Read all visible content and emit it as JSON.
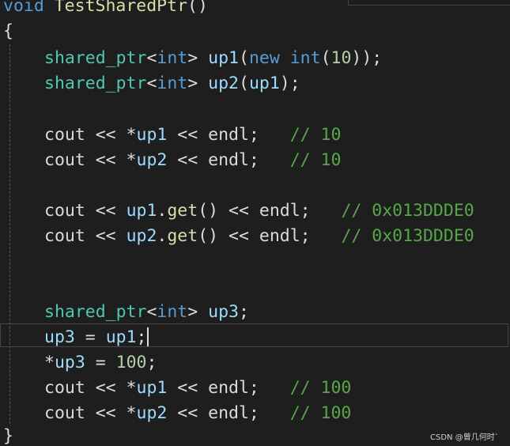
{
  "watermark": "CSDN @曾几何时`",
  "nav": {
    "dropdown_arrow": "▾"
  },
  "lines": [
    {
      "id": "l0",
      "tokens": [
        {
          "t": "void",
          "c": "kw"
        },
        {
          "t": " ",
          "c": "pln"
        },
        {
          "t": "TestSharedPtr",
          "c": "fn"
        },
        {
          "t": "()",
          "c": "pln"
        }
      ]
    },
    {
      "id": "l1",
      "tokens": [
        {
          "t": "{",
          "c": "pln"
        }
      ]
    },
    {
      "id": "l2",
      "tokens": [
        {
          "t": "shared_ptr",
          "c": "type"
        },
        {
          "t": "<",
          "c": "pln"
        },
        {
          "t": "int",
          "c": "kw"
        },
        {
          "t": "> ",
          "c": "pln"
        },
        {
          "t": "up1",
          "c": "var"
        },
        {
          "t": "(",
          "c": "pln"
        },
        {
          "t": "new",
          "c": "kw"
        },
        {
          "t": " ",
          "c": "pln"
        },
        {
          "t": "int",
          "c": "kw"
        },
        {
          "t": "(",
          "c": "pln"
        },
        {
          "t": "10",
          "c": "num"
        },
        {
          "t": "));",
          "c": "pln"
        }
      ]
    },
    {
      "id": "l3",
      "tokens": [
        {
          "t": "shared_ptr",
          "c": "type"
        },
        {
          "t": "<",
          "c": "pln"
        },
        {
          "t": "int",
          "c": "kw"
        },
        {
          "t": "> ",
          "c": "pln"
        },
        {
          "t": "up2",
          "c": "var"
        },
        {
          "t": "(",
          "c": "pln"
        },
        {
          "t": "up1",
          "c": "var"
        },
        {
          "t": ");",
          "c": "pln"
        }
      ]
    },
    {
      "id": "l5",
      "tokens": [
        {
          "t": "cout",
          "c": "pln"
        },
        {
          "t": " << *",
          "c": "pln"
        },
        {
          "t": "up1",
          "c": "var"
        },
        {
          "t": " << ",
          "c": "pln"
        },
        {
          "t": "endl",
          "c": "pln"
        },
        {
          "t": ";   ",
          "c": "pln"
        },
        {
          "t": "// 10",
          "c": "cmt"
        }
      ]
    },
    {
      "id": "l6",
      "tokens": [
        {
          "t": "cout",
          "c": "pln"
        },
        {
          "t": " << *",
          "c": "pln"
        },
        {
          "t": "up2",
          "c": "var"
        },
        {
          "t": " << ",
          "c": "pln"
        },
        {
          "t": "endl",
          "c": "pln"
        },
        {
          "t": ";   ",
          "c": "pln"
        },
        {
          "t": "// 10",
          "c": "cmt"
        }
      ]
    },
    {
      "id": "l8",
      "tokens": [
        {
          "t": "cout",
          "c": "pln"
        },
        {
          "t": " << ",
          "c": "pln"
        },
        {
          "t": "up1",
          "c": "var"
        },
        {
          "t": ".",
          "c": "pln"
        },
        {
          "t": "get",
          "c": "fn"
        },
        {
          "t": "() << ",
          "c": "pln"
        },
        {
          "t": "endl",
          "c": "pln"
        },
        {
          "t": ";   ",
          "c": "pln"
        },
        {
          "t": "// 0x013DDDE0",
          "c": "cmt"
        }
      ]
    },
    {
      "id": "l9",
      "tokens": [
        {
          "t": "cout",
          "c": "pln"
        },
        {
          "t": " << ",
          "c": "pln"
        },
        {
          "t": "up2",
          "c": "var"
        },
        {
          "t": ".",
          "c": "pln"
        },
        {
          "t": "get",
          "c": "fn"
        },
        {
          "t": "() << ",
          "c": "pln"
        },
        {
          "t": "endl",
          "c": "pln"
        },
        {
          "t": ";   ",
          "c": "pln"
        },
        {
          "t": "// 0x013DDDE0",
          "c": "cmt"
        }
      ]
    },
    {
      "id": "l12",
      "tokens": [
        {
          "t": "shared_ptr",
          "c": "type"
        },
        {
          "t": "<",
          "c": "pln"
        },
        {
          "t": "int",
          "c": "kw"
        },
        {
          "t": "> ",
          "c": "pln"
        },
        {
          "t": "up3",
          "c": "var"
        },
        {
          "t": ";",
          "c": "pln"
        }
      ]
    },
    {
      "id": "l13",
      "tokens": [
        {
          "t": "up3",
          "c": "var"
        },
        {
          "t": " = ",
          "c": "pln"
        },
        {
          "t": "up1",
          "c": "var"
        },
        {
          "t": ";",
          "c": "pln"
        }
      ]
    },
    {
      "id": "l14",
      "tokens": [
        {
          "t": "*",
          "c": "pln"
        },
        {
          "t": "up3",
          "c": "var"
        },
        {
          "t": " = ",
          "c": "pln"
        },
        {
          "t": "100",
          "c": "num"
        },
        {
          "t": ";",
          "c": "pln"
        }
      ]
    },
    {
      "id": "l15",
      "tokens": [
        {
          "t": "cout",
          "c": "pln"
        },
        {
          "t": " << *",
          "c": "pln"
        },
        {
          "t": "up1",
          "c": "var"
        },
        {
          "t": " << ",
          "c": "pln"
        },
        {
          "t": "endl",
          "c": "pln"
        },
        {
          "t": ";   ",
          "c": "pln"
        },
        {
          "t": "// 100",
          "c": "cmt"
        }
      ]
    },
    {
      "id": "l16",
      "tokens": [
        {
          "t": "cout",
          "c": "pln"
        },
        {
          "t": " << *",
          "c": "pln"
        },
        {
          "t": "up2",
          "c": "var"
        },
        {
          "t": " << ",
          "c": "pln"
        },
        {
          "t": "endl",
          "c": "pln"
        },
        {
          "t": ";   ",
          "c": "pln"
        },
        {
          "t": "// 100",
          "c": "cmt"
        }
      ]
    },
    {
      "id": "l17",
      "tokens": [
        {
          "t": "}",
          "c": "pln"
        }
      ]
    }
  ],
  "colors": {
    "background": "#1e1e1e",
    "keyword": "#569cd6",
    "type": "#4ec9b0",
    "variable": "#9cdcfe",
    "number": "#b5cea8",
    "comment": "#57a64a",
    "plain": "#dcdcdc",
    "function": "#dcdcaa"
  }
}
